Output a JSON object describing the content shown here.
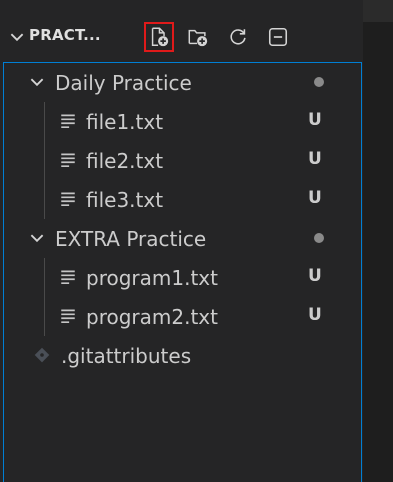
{
  "explorer": {
    "title": "PRACT...",
    "toolbar": {
      "new_file_icon": "new-file-icon",
      "new_folder_icon": "new-folder-icon",
      "refresh_icon": "refresh-icon",
      "collapse_icon": "collapse-all-icon"
    },
    "folders": [
      {
        "name": "Daily Practice",
        "files": [
          {
            "name": "file1.txt",
            "status": "U"
          },
          {
            "name": "file2.txt",
            "status": "U"
          },
          {
            "name": "file3.txt",
            "status": "U"
          }
        ]
      },
      {
        "name": "EXTRA Practice",
        "files": [
          {
            "name": "program1.txt",
            "status": "U"
          },
          {
            "name": "program2.txt",
            "status": "U"
          }
        ]
      }
    ],
    "root_files": [
      {
        "name": ".gitattributes",
        "icon": "git-diamond-icon"
      }
    ]
  },
  "colors": {
    "background": "#252526",
    "focus_border": "#007fd4",
    "highlight_box": "#e01a1a",
    "text": "#cccccc"
  }
}
